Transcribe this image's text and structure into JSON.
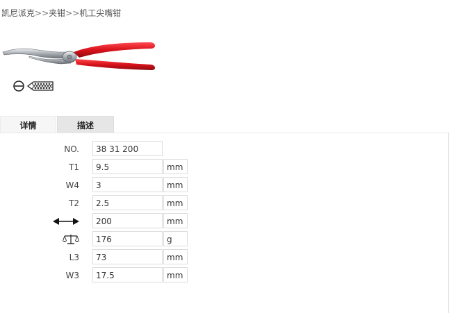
{
  "breadcrumb": {
    "items": [
      "凯尼派克",
      "夹钳",
      "机工尖嘴钳"
    ],
    "separator": ">>"
  },
  "tabs": [
    {
      "label": "详情",
      "active": true
    },
    {
      "label": "描述",
      "active": false
    }
  ],
  "specs": [
    {
      "label": "NO.",
      "value": "38 31 200",
      "unit": ""
    },
    {
      "label": "T1",
      "value": "9.5",
      "unit": "mm"
    },
    {
      "label": "W4",
      "value": "3",
      "unit": "mm"
    },
    {
      "label": "T2",
      "value": "2.5",
      "unit": "mm"
    },
    {
      "label": "",
      "icon": "length-arrow-icon",
      "value": "200",
      "unit": "mm"
    },
    {
      "label": "",
      "icon": "weight-scale-icon",
      "value": "176",
      "unit": "g"
    },
    {
      "label": "L3",
      "value": "73",
      "unit": "mm"
    },
    {
      "label": "W3",
      "value": "17.5",
      "unit": "mm"
    }
  ],
  "colors": {
    "handle": "#d8121b",
    "metal": "#b8bcc0"
  }
}
